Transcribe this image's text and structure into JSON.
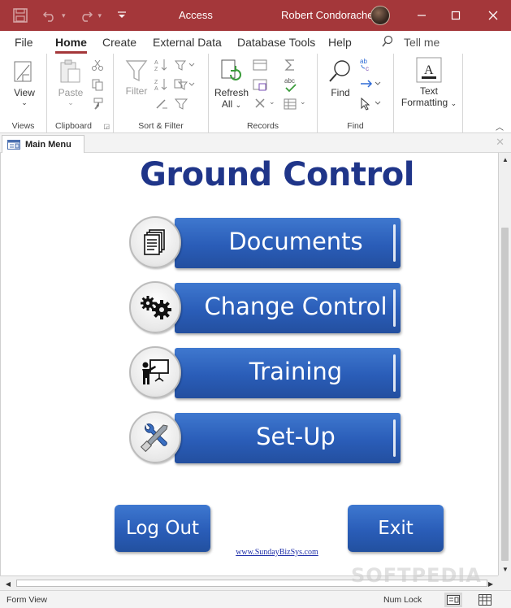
{
  "titlebar": {
    "app_title": "Access",
    "user_name": "Robert Condorache",
    "background": "#a4373a"
  },
  "tabs": [
    {
      "label": "File"
    },
    {
      "label": "Home"
    },
    {
      "label": "Create"
    },
    {
      "label": "External Data"
    },
    {
      "label": "Database Tools"
    },
    {
      "label": "Help"
    }
  ],
  "tell_me": "Tell me",
  "ribbon": {
    "views": {
      "label": "Views",
      "view_button": "View"
    },
    "clipboard": {
      "label": "Clipboard",
      "paste": "Paste"
    },
    "sort_filter": {
      "label": "Sort & Filter",
      "filter": "Filter"
    },
    "records": {
      "label": "Records",
      "refresh": "Refresh",
      "refresh_all": "All"
    },
    "find": {
      "label": "Find",
      "find_button": "Find"
    },
    "text_formatting": {
      "line1": "Text",
      "line2": "Formatting"
    }
  },
  "document_tab": {
    "label": "Main Menu"
  },
  "form": {
    "title": "Ground Control",
    "title_color": "#1f3589",
    "menu_items": [
      {
        "label": "Documents",
        "icon": "documents-icon"
      },
      {
        "label": "Change Control",
        "icon": "gears-icon"
      },
      {
        "label": "Training",
        "icon": "presentation-icon"
      },
      {
        "label": "Set-Up",
        "icon": "tools-icon"
      }
    ],
    "logout_label": "Log Out",
    "exit_label": "Exit",
    "website_link": "www.SundayBizSys.com",
    "button_color": "#2a5db8"
  },
  "status": {
    "view_name": "Form View",
    "num_lock": "Num Lock"
  },
  "watermark": "SOFTPEDIA"
}
